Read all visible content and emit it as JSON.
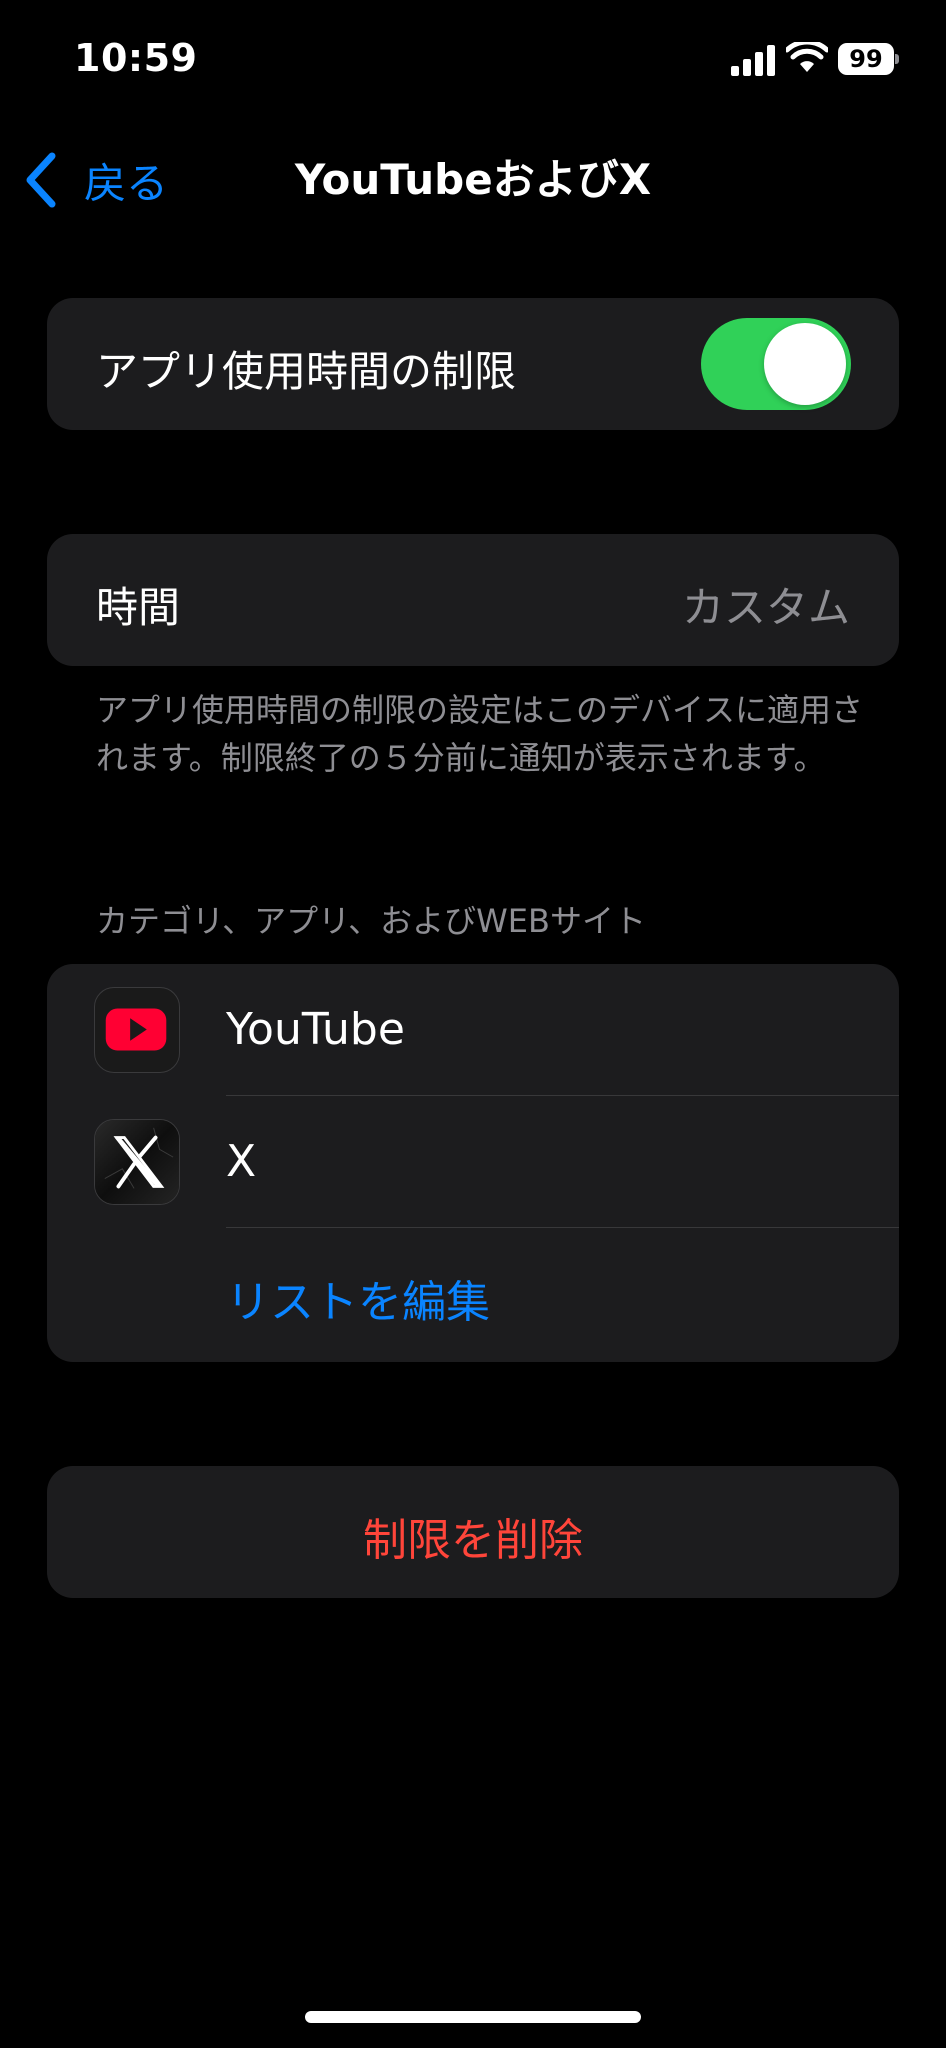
{
  "status_bar": {
    "time": "10:59",
    "battery_percent": "99"
  },
  "nav": {
    "back_label": "戻る",
    "title": "YouTubeおよびX"
  },
  "app_limit": {
    "label": "アプリ使用時間の制限",
    "enabled": true
  },
  "time_row": {
    "label": "時間",
    "value": "カスタム"
  },
  "footnote": "アプリ使用時間の制限の設定はこのデバイスに適用されます。制限終了の５分前に通知が表示されます。",
  "apps_section": {
    "header": "カテゴリ、アプリ、およびWEBサイト",
    "items": [
      {
        "name": "YouTube",
        "icon": "youtube-icon"
      },
      {
        "name": "X",
        "icon": "x-icon"
      }
    ],
    "edit_label": "リストを編集"
  },
  "delete_label": "制限を削除",
  "colors": {
    "background": "#000000",
    "card": "#1c1c1e",
    "accent": "#0a84ff",
    "toggle_on": "#30d158",
    "destructive": "#ff453a",
    "secondary_text": "#8e8e93"
  }
}
